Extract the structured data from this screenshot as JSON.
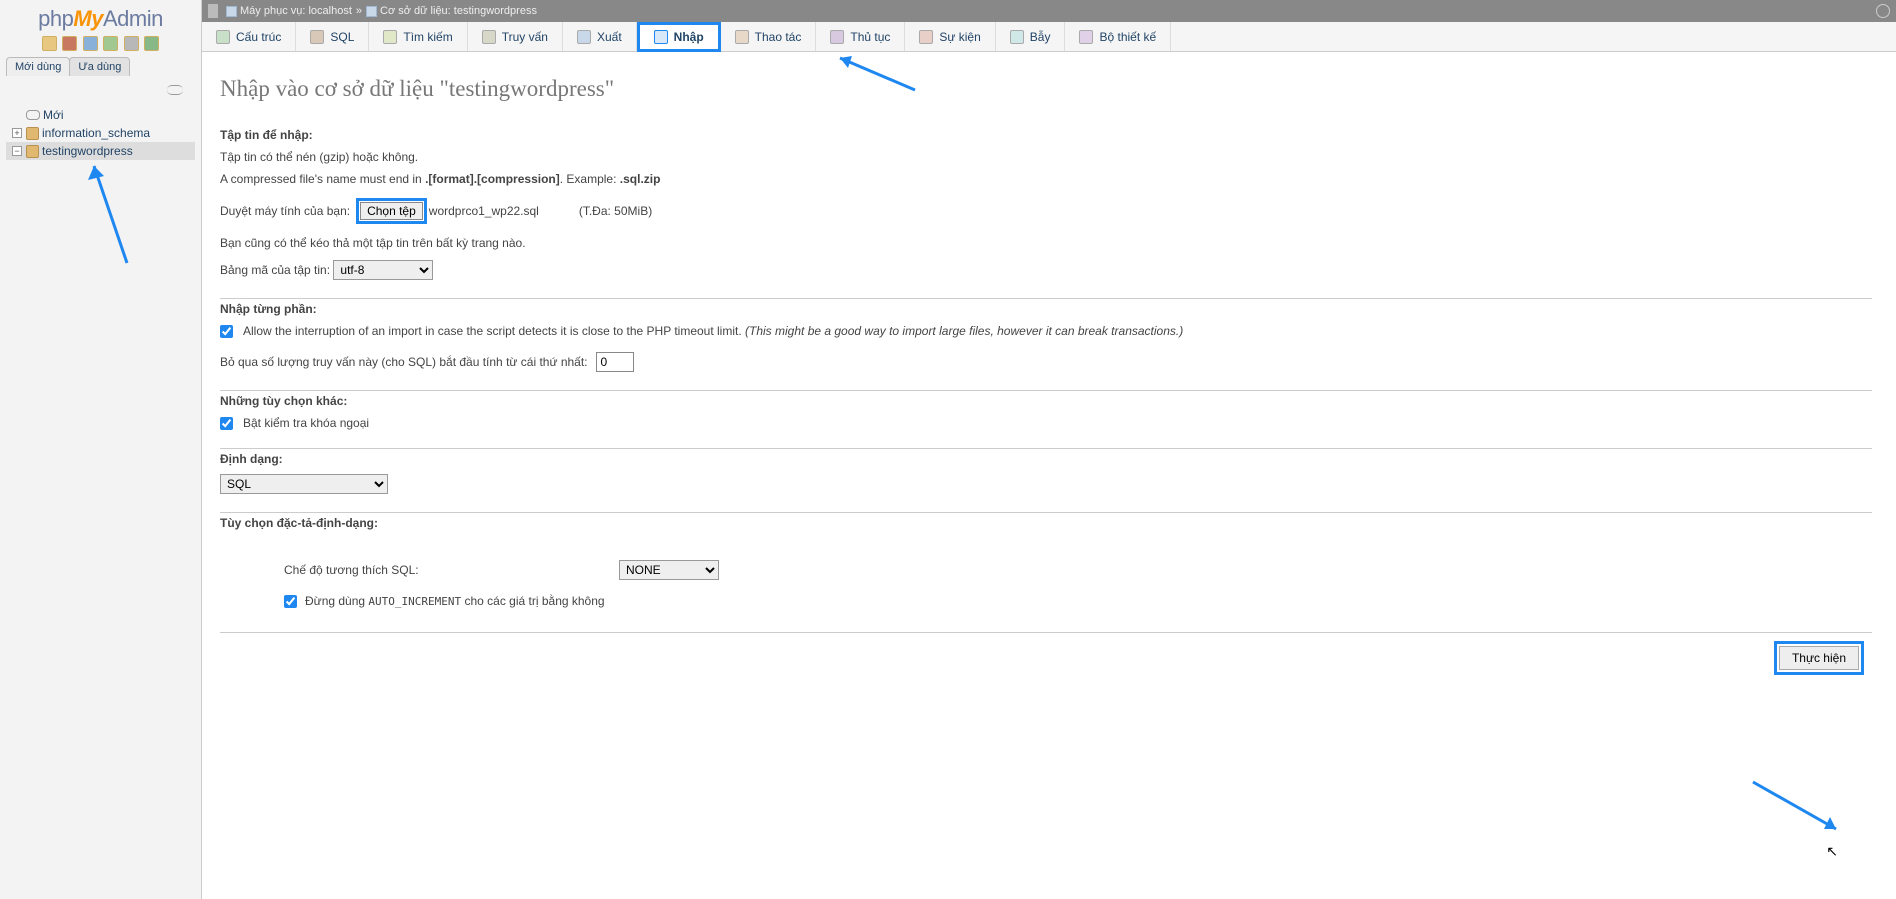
{
  "sidebar": {
    "brand_pre": "php",
    "brand_mid": "My",
    "brand_post": "Admin",
    "tabs": [
      "Mới dùng",
      "Ưa dùng"
    ],
    "tree": {
      "new": "Mới",
      "items": [
        "information_schema",
        "testingwordpress"
      ]
    }
  },
  "breadcrumb": {
    "server_pre": "Máy phục vụ: ",
    "server": "localhost",
    "sep": " » ",
    "db_pre": "Cơ sở dữ liệu: ",
    "db": "testingwordpress"
  },
  "tabs": [
    {
      "label": "Cấu trúc"
    },
    {
      "label": "SQL"
    },
    {
      "label": "Tìm kiếm"
    },
    {
      "label": "Truy vấn"
    },
    {
      "label": "Xuất"
    },
    {
      "label": "Nhập"
    },
    {
      "label": "Thao tác"
    },
    {
      "label": "Thủ tục"
    },
    {
      "label": "Sự kiện"
    },
    {
      "label": "Bẫy"
    },
    {
      "label": "Bộ thiết kế"
    }
  ],
  "heading": "Nhập vào cơ sở dữ liệu \"testingwordpress\"",
  "fileSection": {
    "title": "Tập tin để nhập:",
    "line1": "Tập tin có thể nén (gzip) hoặc không.",
    "line2_a": "A compressed file's name must end in ",
    "line2_b": ".[format].[compression]",
    "line2_c": ". Example: ",
    "line2_d": ".sql.zip",
    "browseLabel": "Duyệt máy tính của bạn:",
    "browseBtn": "Chọn tệp",
    "filename": "wordprco1_wp22.sql",
    "maxSize": "(T.Đa: 50MiB)",
    "dropLine": "Bạn cũng có thể kéo thả một tập tin trên bất kỳ trang nào.",
    "charsetLabel": "Bảng mã của tập tin:",
    "charsetValue": "utf-8"
  },
  "partialSection": {
    "title": "Nhập từng phần:",
    "chkText": "Allow the interruption of an import in case the script detects it is close to the PHP timeout limit.",
    "chkHint": "(This might be a good way to import large files, however it can break transactions.)",
    "skipLabel": "Bỏ qua số lượng truy vấn này (cho SQL) bắt đầu tính từ cái thứ nhất:",
    "skipValue": "0"
  },
  "otherSection": {
    "title": "Những tùy chọn khác:",
    "fkLabel": "Bật kiểm tra khóa ngoại"
  },
  "formatSection": {
    "title": "Định dạng:",
    "value": "SQL"
  },
  "specSection": {
    "title": "Tùy chọn đặc-tả-định-dạng:",
    "compatLabel": "Chế độ tương thích SQL:",
    "compatValue": "NONE",
    "aiPre": "Đừng dùng ",
    "aiMono": "AUTO_INCREMENT",
    "aiPost": " cho các giá trị bằng không"
  },
  "submit": "Thực hiện"
}
